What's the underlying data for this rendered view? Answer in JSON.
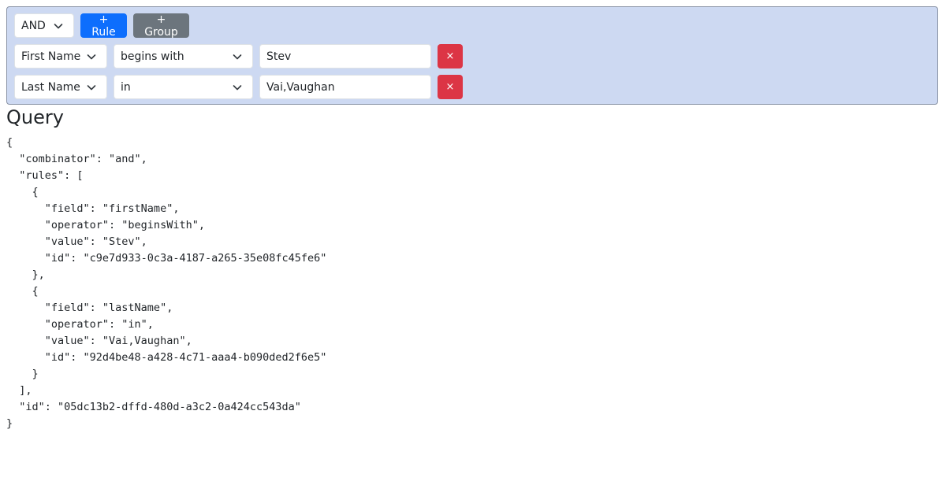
{
  "builder": {
    "combinator": {
      "label": "AND"
    },
    "add_rule_label": "+ Rule",
    "add_group_label": "+ Group",
    "rules": [
      {
        "field": "First Name",
        "operator": "begins with",
        "value": "Stev",
        "remove_label": "×"
      },
      {
        "field": "Last Name",
        "operator": "in",
        "value": "Vai,Vaughan",
        "remove_label": "×"
      }
    ]
  },
  "query": {
    "title": "Query",
    "code": "{\n  \"combinator\": \"and\",\n  \"rules\": [\n    {\n      \"field\": \"firstName\",\n      \"operator\": \"beginsWith\",\n      \"value\": \"Stev\",\n      \"id\": \"c9e7d933-0c3a-4187-a265-35e08fc45fe6\"\n    },\n    {\n      \"field\": \"lastName\",\n      \"operator\": \"in\",\n      \"value\": \"Vai,Vaughan\",\n      \"id\": \"92d4be48-a428-4c71-aaa4-b090ded2f6e5\"\n    }\n  ],\n  \"id\": \"05dc13b2-dffd-480d-a3c2-0a424cc543da\"\n}"
  },
  "icons": {
    "select_arrow": "chevron-down-icon",
    "remove": "close-icon"
  },
  "colors": {
    "group_bg": "#cdd9f2",
    "primary": "#0d6efd",
    "secondary": "#6c757d",
    "danger": "#dc3545"
  }
}
